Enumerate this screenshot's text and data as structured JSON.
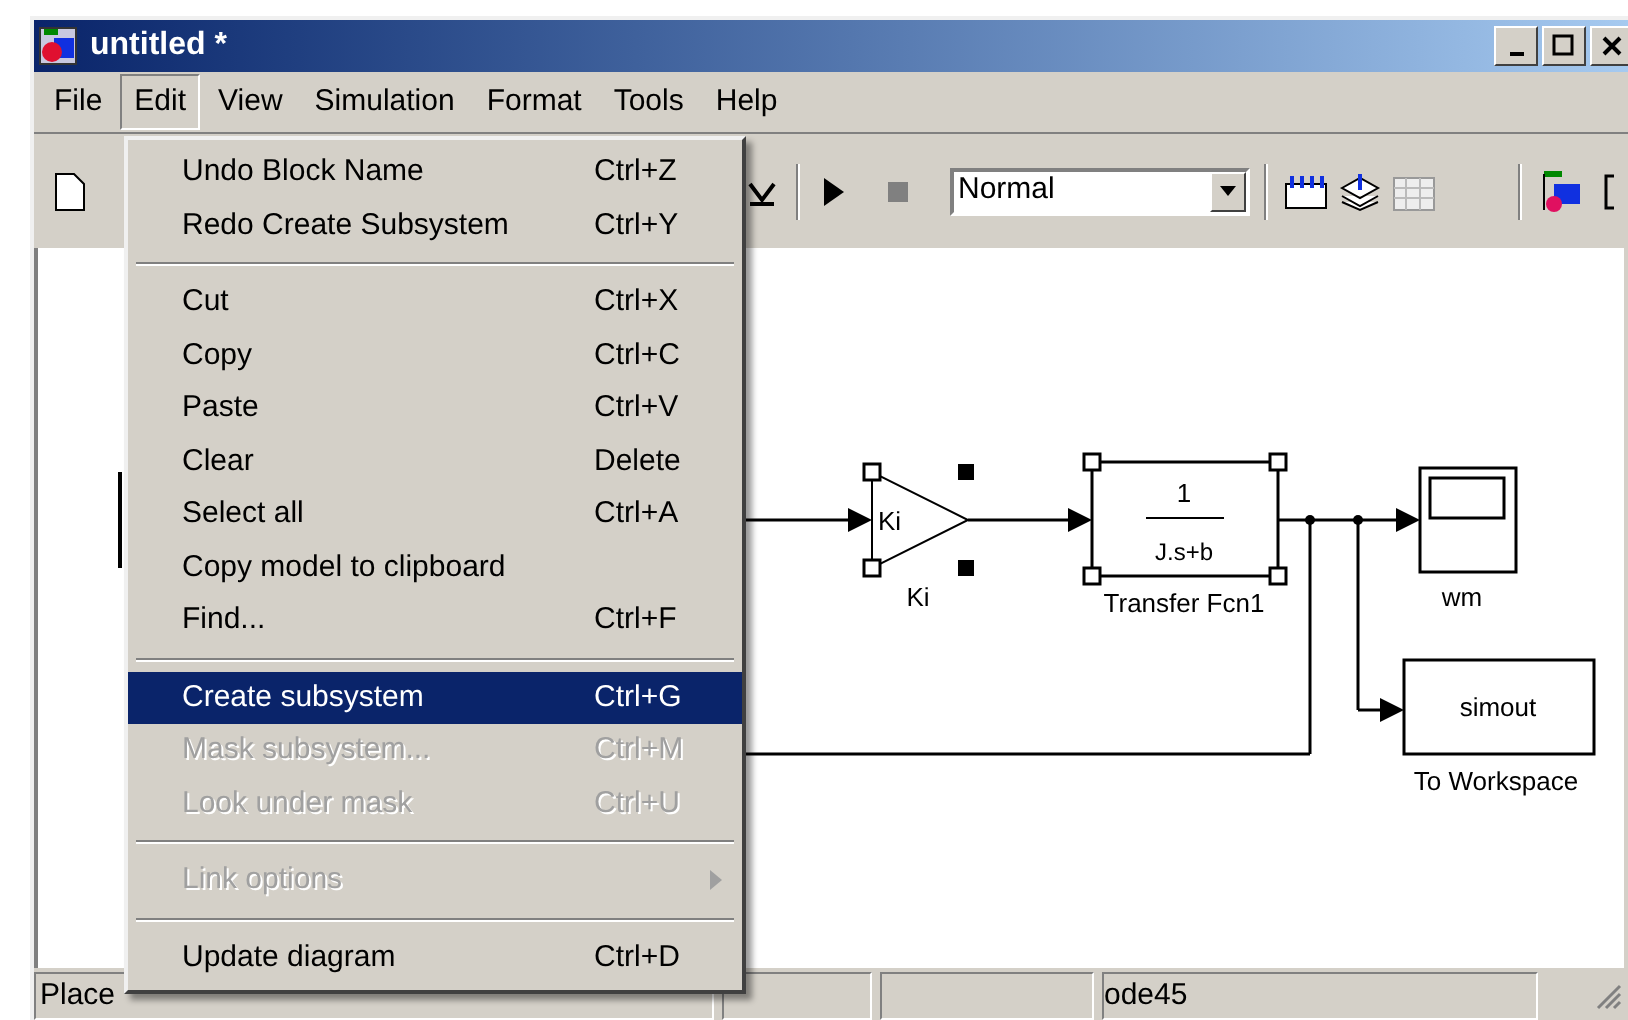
{
  "window": {
    "title": "untitled *"
  },
  "menu_bar": [
    {
      "label": "File",
      "selected": false
    },
    {
      "label": "Edit",
      "selected": true
    },
    {
      "label": "View",
      "selected": false
    },
    {
      "label": "Simulation",
      "selected": false
    },
    {
      "label": "Format",
      "selected": false
    },
    {
      "label": "Tools",
      "selected": false
    },
    {
      "label": "Help",
      "selected": false
    }
  ],
  "edit_menu": [
    {
      "kind": "item",
      "label": "Undo Block Name",
      "shortcut": "Ctrl+Z",
      "disabled": false,
      "selected": false
    },
    {
      "kind": "item",
      "label": "Redo Create Subsystem",
      "shortcut": "Ctrl+Y",
      "disabled": false,
      "selected": false
    },
    {
      "kind": "separator"
    },
    {
      "kind": "item",
      "label": "Cut",
      "shortcut": "Ctrl+X",
      "disabled": false,
      "selected": false
    },
    {
      "kind": "item",
      "label": "Copy",
      "shortcut": "Ctrl+C",
      "disabled": false,
      "selected": false
    },
    {
      "kind": "item",
      "label": "Paste",
      "shortcut": "Ctrl+V",
      "disabled": false,
      "selected": false
    },
    {
      "kind": "item",
      "label": "Clear",
      "shortcut": "Delete",
      "disabled": false,
      "selected": false
    },
    {
      "kind": "item",
      "label": "Select all",
      "shortcut": "Ctrl+A",
      "disabled": false,
      "selected": false
    },
    {
      "kind": "item",
      "label": "Copy model to clipboard",
      "disabled": false,
      "selected": false
    },
    {
      "kind": "item",
      "label": "Find...",
      "shortcut": "Ctrl+F",
      "disabled": false,
      "selected": false
    },
    {
      "kind": "separator"
    },
    {
      "kind": "item",
      "label": "Create subsystem",
      "shortcut": "Ctrl+G",
      "disabled": false,
      "selected": true
    },
    {
      "kind": "item",
      "label": "Mask subsystem...",
      "shortcut": "Ctrl+M",
      "disabled": true,
      "selected": false
    },
    {
      "kind": "item",
      "label": "Look under mask",
      "shortcut": "Ctrl+U",
      "disabled": true,
      "selected": false
    },
    {
      "kind": "separator"
    },
    {
      "kind": "submenu",
      "label": "Link options",
      "disabled": true,
      "selected": false
    },
    {
      "kind": "separator"
    },
    {
      "kind": "item",
      "label": "Update diagram",
      "shortcut": "Ctrl+D",
      "disabled": false,
      "selected": false
    }
  ],
  "toolbar": {
    "simulation_mode": "Normal"
  },
  "diagram": {
    "gain": {
      "symbol": "Ki",
      "label": "Ki",
      "selected": true
    },
    "transfer_function": {
      "numerator": "1",
      "denominator": "J.s+b",
      "label": "Transfer Fcn1",
      "selected": true
    },
    "scope": {
      "label": "wm"
    },
    "to_workspace": {
      "variable": "simout",
      "label": "To Workspace"
    }
  },
  "status_bar": {
    "message": "Place",
    "solver": "ode45"
  }
}
